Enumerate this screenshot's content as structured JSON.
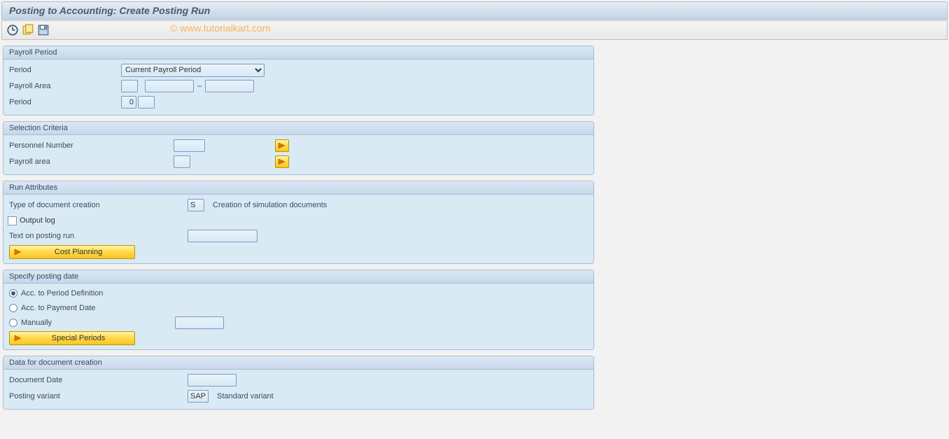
{
  "title": "Posting to Accounting: Create Posting Run",
  "watermark": "© www.tutorialkart.com",
  "groups": {
    "payroll_period": {
      "title": "Payroll Period",
      "period_label": "Period",
      "period_value": "Current Payroll Period",
      "payroll_area_label": "Payroll Area",
      "payroll_area_value": "",
      "payroll_sub1": "",
      "payroll_sub2": "",
      "period2_label": "Period",
      "period2_value": "0",
      "period2_extra": ""
    },
    "selection_criteria": {
      "title": "Selection Criteria",
      "personnel_number_label": "Personnel Number",
      "personnel_number_value": "",
      "payroll_area_label": "Payroll area",
      "payroll_area_value": ""
    },
    "run_attributes": {
      "title": "Run Attributes",
      "doc_type_label": "Type of document creation",
      "doc_type_value": "S",
      "doc_type_text": "Creation of simulation documents",
      "output_log_label": "Output log",
      "text_posting_label": "Text on posting run",
      "text_posting_value": "",
      "cost_planning_btn": "Cost Planning"
    },
    "posting_date": {
      "title": "Specify posting date",
      "opt1": "Acc. to Period Definition",
      "opt2": "Acc. to Payment Date",
      "opt3": "Manually",
      "manual_value": "",
      "special_periods_btn": "Special Periods"
    },
    "doc_creation": {
      "title": "Data for document creation",
      "doc_date_label": "Document Date",
      "doc_date_value": "",
      "posting_variant_label": "Posting variant",
      "posting_variant_value": "SAP",
      "posting_variant_text": "Standard variant"
    }
  }
}
